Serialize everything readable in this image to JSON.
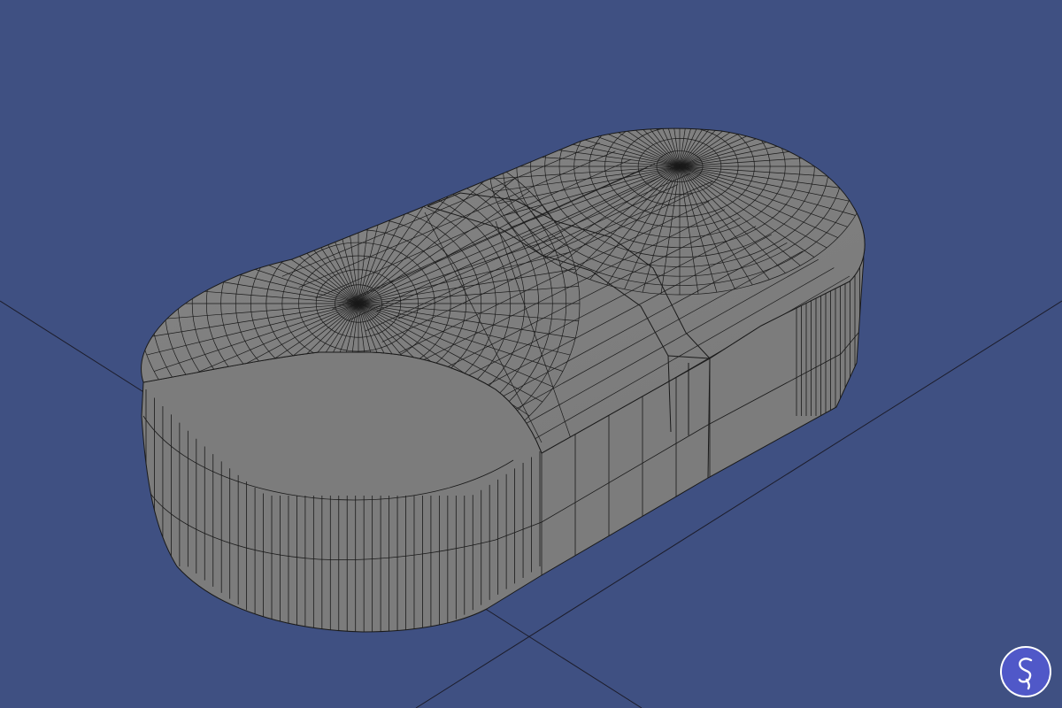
{
  "viewport": {
    "background": "#3f5082",
    "model": {
      "shape": "capsule (stadium) solid with rounded ends",
      "fill": "#7b7b7b",
      "wire_color": "#1a1a1a"
    },
    "axes_color": "#1c1c2a"
  },
  "logo": {
    "icon": "app-logo-s-icon",
    "background": "#5058c8",
    "ring": "#ffffff"
  }
}
